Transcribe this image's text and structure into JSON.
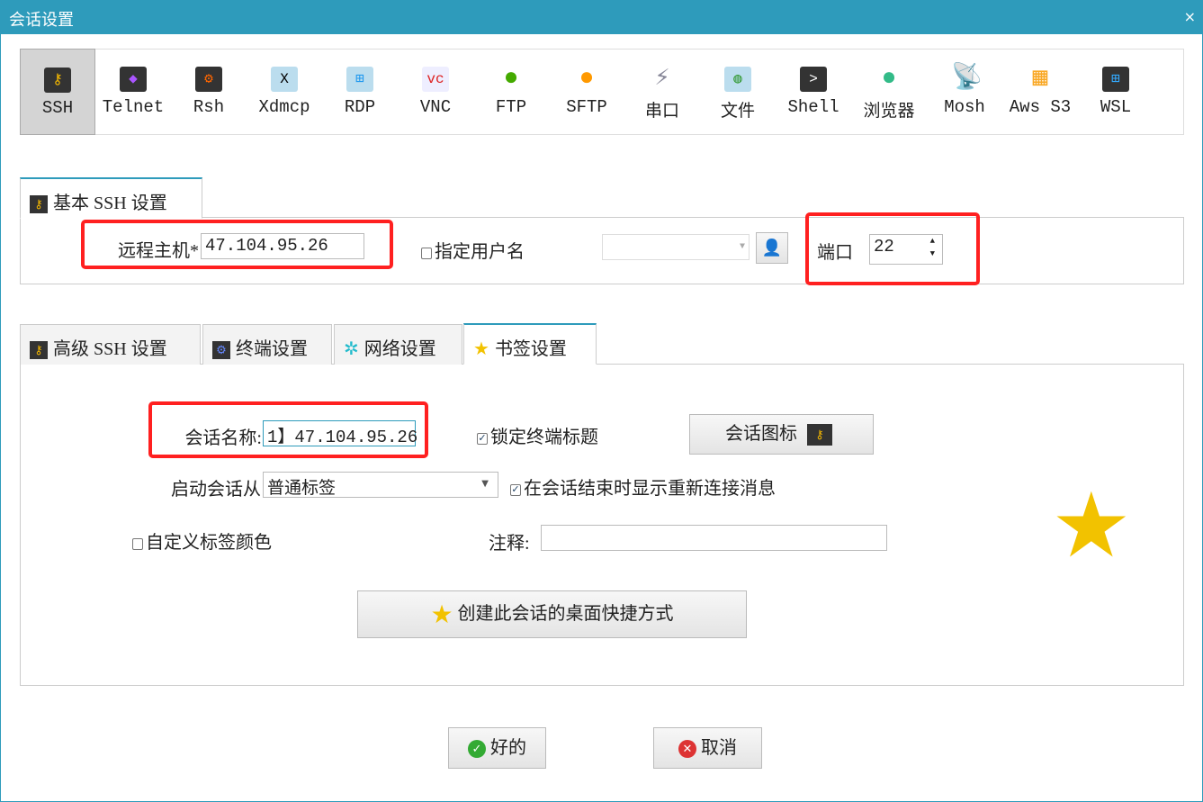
{
  "window": {
    "title": "会话设置",
    "close_icon": "×"
  },
  "protocols": [
    {
      "label": "SSH",
      "icon": "key-icon",
      "selected": true
    },
    {
      "label": "Telnet",
      "icon": "gem-icon"
    },
    {
      "label": "Rsh",
      "icon": "gears-icon"
    },
    {
      "label": "Xdmcp",
      "icon": "x-monitor-icon"
    },
    {
      "label": "RDP",
      "icon": "windows-monitor-icon"
    },
    {
      "label": "VNC",
      "icon": "vnc-monitor-icon"
    },
    {
      "label": "FTP",
      "icon": "green-globe-icon"
    },
    {
      "label": "SFTP",
      "icon": "orange-globe-icon"
    },
    {
      "label": "串口",
      "icon": "plug-icon"
    },
    {
      "label": "文件",
      "icon": "globe-monitor-icon"
    },
    {
      "label": "Shell",
      "icon": "terminal-icon"
    },
    {
      "label": "浏览器",
      "icon": "globe-icon"
    },
    {
      "label": "Mosh",
      "icon": "satellite-dish-icon"
    },
    {
      "label": "Aws S3",
      "icon": "cubes-icon"
    },
    {
      "label": "WSL",
      "icon": "windows-icon"
    }
  ],
  "basic": {
    "tab": "基本 SSH 设置",
    "host_label": "远程主机*",
    "host_value": "47.104.95.26",
    "username_label": "指定用户名",
    "username_checked": false,
    "port_label": "端口",
    "port_value": "22"
  },
  "tabs": [
    {
      "label": "高级 SSH 设置"
    },
    {
      "label": "终端设置"
    },
    {
      "label": "网络设置"
    },
    {
      "label": "书签设置",
      "active": true
    }
  ],
  "bookmark": {
    "session_name_label": "会话名称:",
    "session_name_value": "1】47.104.95.26",
    "lock_title_label": "锁定终端标题",
    "lock_title_checked": true,
    "session_icon_button": "会话图标",
    "start_from_label": "启动会话从",
    "start_from_value": "普通标签",
    "reconnect_label": "在会话结束时显示重新连接消息",
    "reconnect_checked": true,
    "custom_color_label": "自定义标签颜色",
    "custom_color_checked": false,
    "comment_label": "注释:",
    "comment_value": "",
    "shortcut_button": "创建此会话的桌面快捷方式"
  },
  "footer": {
    "ok": "好的",
    "cancel": "取消"
  },
  "colors": {
    "titlebar": "#2e9bbb",
    "highlight": "#ff2020",
    "star": "#f2c200"
  }
}
